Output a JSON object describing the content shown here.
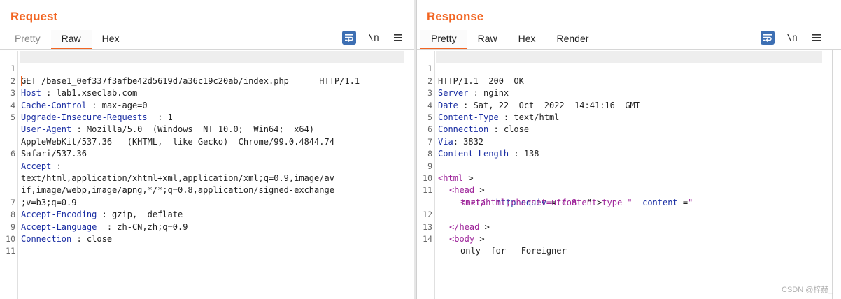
{
  "request": {
    "title": "Request",
    "tabs": [
      {
        "label": "Pretty",
        "active": false
      },
      {
        "label": "Raw",
        "active": true
      },
      {
        "label": "Hex",
        "active": false
      }
    ],
    "newline_label": "\\n",
    "lines": [
      {
        "n": "1",
        "key": "",
        "text": "GET /base1_0ef337f3afbe42d5619d7a36c19c20ab/index.php      HTTP/1.1"
      },
      {
        "n": "2",
        "key": "Host",
        "text": " : lab1.xseclab.com"
      },
      {
        "n": "3",
        "key": "Cache-Control",
        "text": " : max-age=0"
      },
      {
        "n": "4",
        "key": "Upgrade-Insecure-Requests",
        "text": "  : 1"
      },
      {
        "n": "5",
        "key": "User-Agent",
        "text": " : Mozilla/5.0  (Windows  NT 10.0;  Win64;  x64)"
      },
      {
        "n": "",
        "key": "",
        "text": "AppleWebKit/537.36   (KHTML,  like Gecko)  Chrome/99.0.4844.74"
      },
      {
        "n": "",
        "key": "",
        "text": "Safari/537.36"
      },
      {
        "n": "6",
        "key": "Accept",
        "text": " :"
      },
      {
        "n": "",
        "key": "",
        "text": "text/html,application/xhtml+xml,application/xml;q=0.9,image/av"
      },
      {
        "n": "",
        "key": "",
        "text": "if,image/webp,image/apng,*/*;q=0.8,application/signed-exchange"
      },
      {
        "n": "",
        "key": "",
        "text": ";v=b3;q=0.9"
      },
      {
        "n": "7",
        "key": "Accept-Encoding",
        "text": " : gzip,  deflate"
      },
      {
        "n": "8",
        "key": "Accept-Language",
        "text": "  : zh-CN,zh;q=0.9"
      },
      {
        "n": "9",
        "key": "Connection",
        "text": " : close"
      },
      {
        "n": "10",
        "key": "",
        "text": ""
      },
      {
        "n": "11",
        "key": "",
        "text": ""
      }
    ]
  },
  "response": {
    "title": "Response",
    "tabs": [
      {
        "label": "Pretty",
        "active": true
      },
      {
        "label": "Raw",
        "active": false
      },
      {
        "label": "Hex",
        "active": false
      },
      {
        "label": "Render",
        "active": false
      }
    ],
    "newline_label": "\\n",
    "headers": [
      {
        "n": "1",
        "key": "",
        "text": "HTTP/1.1  200  OK"
      },
      {
        "n": "2",
        "key": "Server",
        "text": " : nginx"
      },
      {
        "n": "3",
        "key": "Date",
        "text": " : Sat, 22  Oct  2022  14:41:16  GMT"
      },
      {
        "n": "4",
        "key": "Content-Type",
        "text": " : text/html"
      },
      {
        "n": "5",
        "key": "Connection",
        "text": " : close"
      },
      {
        "n": "6",
        "key": "Via",
        "text": ": 3832"
      },
      {
        "n": "7",
        "key": "Content-Length",
        "text": " : 138"
      },
      {
        "n": "8",
        "key": "",
        "text": ""
      }
    ],
    "html_lines": {
      "l9": {
        "n": "9",
        "tag": "<html",
        "close": " >"
      },
      "l10": {
        "n": "10",
        "tag": "<head",
        "close": " >"
      },
      "l11": {
        "n": "11",
        "tag": "<meta",
        "attr1": "http-equiv",
        "eq1": " =",
        "val1": "\"content-type \"",
        "attr2": "content",
        "eq2": " =",
        "val2": "\""
      },
      "l11b": {
        "val": "text/html;charset=utf-8",
        "close": "\" >"
      },
      "l12": {
        "n": "12",
        "tag": "</head",
        "close": " >"
      },
      "l13": {
        "n": "13",
        "tag": "<body",
        "close": " >"
      },
      "l14": {
        "n": "14",
        "text": "only  for   Foreigner"
      }
    }
  },
  "layout_buttons": [
    {
      "name": "side-by-side",
      "active": true
    },
    {
      "name": "top-bottom",
      "active": false
    },
    {
      "name": "single-pane",
      "active": false
    }
  ],
  "watermark": "CSDN @梓赫_",
  "colors": {
    "accent": "#f26522",
    "header_key": "#1a2ea3",
    "tag": "#9d2399",
    "button_blue": "#3d6fb3"
  }
}
